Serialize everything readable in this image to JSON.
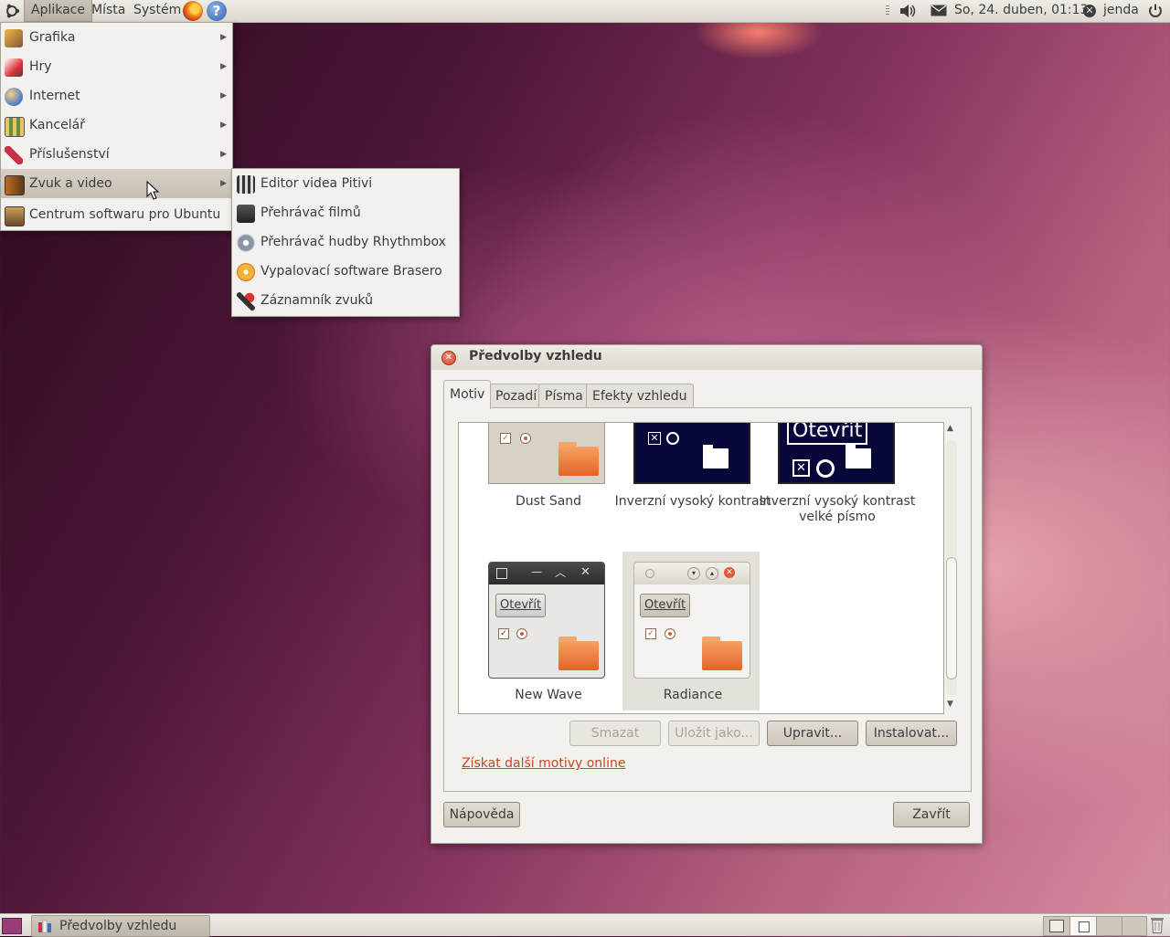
{
  "top_panel": {
    "menus": [
      "Aplikace",
      "Místa",
      "Systém"
    ],
    "clock": "So, 24. duben, 01:13",
    "user": "jenda",
    "icons": [
      "ubuntu-logo-icon",
      "firefox-icon",
      "help-icon",
      "volume-icon",
      "mail-icon",
      "user-status-icon",
      "power-icon"
    ]
  },
  "apps_menu": {
    "items": [
      {
        "label": "Grafika",
        "icon": "graphics-icon",
        "submenu": true
      },
      {
        "label": "Hry",
        "icon": "games-icon",
        "submenu": true
      },
      {
        "label": "Internet",
        "icon": "internet-icon",
        "submenu": true
      },
      {
        "label": "Kancelář",
        "icon": "office-icon",
        "submenu": true
      },
      {
        "label": "Příslušenství",
        "icon": "accessories-icon",
        "submenu": true
      },
      {
        "label": "Zvuk a video",
        "icon": "sound-video-icon",
        "submenu": true,
        "active": true
      },
      {
        "label": "Centrum softwaru pro Ubuntu",
        "icon": "software-center-icon",
        "submenu": false
      }
    ]
  },
  "av_menu": {
    "items": [
      {
        "label": "Editor videa Pitivi",
        "icon": "video-editor-icon"
      },
      {
        "label": "Přehrávač filmů",
        "icon": "movie-player-icon"
      },
      {
        "label": "Přehrávač hudby Rhythmbox",
        "icon": "rhythmbox-icon"
      },
      {
        "label": "Vypalovací software Brasero",
        "icon": "brasero-icon"
      },
      {
        "label": "Záznamník zvuků",
        "icon": "microphone-icon"
      }
    ]
  },
  "dialog": {
    "title": "Předvolby vzhledu",
    "tabs": [
      "Motiv",
      "Pozadí",
      "Písma",
      "Efekty vzhledu"
    ],
    "active_tab": "Motiv",
    "themes": [
      {
        "name": "Dust Sand",
        "selected": false
      },
      {
        "name": "Inverzní vysoký kontrast",
        "selected": false
      },
      {
        "name": "Inverzní vysoký kontrast velké písmo",
        "selected": false
      },
      {
        "name": "New Wave",
        "selected": false
      },
      {
        "name": "Radiance",
        "selected": true
      }
    ],
    "preview_button_label": "Otevřít",
    "buttons": {
      "delete": "Smazat",
      "save_as": "Uložit jako...",
      "edit": "Upravit...",
      "install": "Instalovat..."
    },
    "online_link": "Získat další motivy online",
    "help": "Nápověda",
    "close": "Zavřít"
  },
  "bottom_panel": {
    "task": "Předvolby vzhledu"
  },
  "colors": {
    "accent_orange": "#e5632a",
    "link": "#d0431e",
    "panel": "#dcd8d0"
  }
}
